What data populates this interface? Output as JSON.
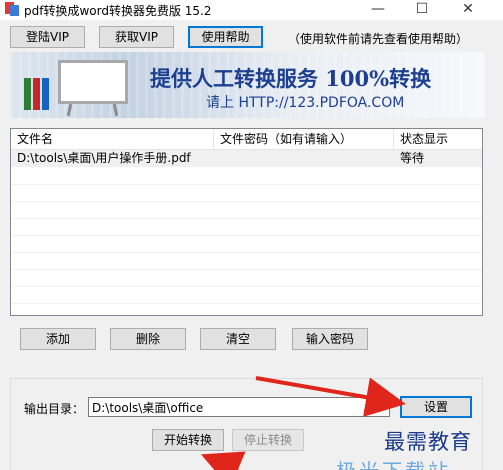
{
  "window": {
    "title": "pdf转换成word转换器免费版 15.2",
    "minimize": "—",
    "maximize": "☐",
    "close": "✕"
  },
  "toolbar": {
    "login_vip": "登陆VIP",
    "get_vip": "获取VIP",
    "help": "使用帮助",
    "hint": "（使用软件前请先查看使用帮助）"
  },
  "banner": {
    "title": "提供人工转换服务 100%转换",
    "subtitle": "请上  HTTP://123.PDFOA.COM"
  },
  "file_list": {
    "columns": [
      "文件名",
      "文件密码（如有请输入）",
      "状态显示"
    ],
    "rows": [
      {
        "name": "D:\\tools\\桌面\\用户操作手册.pdf",
        "password": "",
        "status": "等待"
      }
    ]
  },
  "actions": {
    "add": "添加",
    "delete": "删除",
    "clear": "清空",
    "enter_password": "输入密码"
  },
  "output": {
    "label": "输出目录：",
    "path": "D:\\tools\\桌面\\office",
    "settings": "设置"
  },
  "convert": {
    "start": "开始转换",
    "stop": "停止转换"
  },
  "watermark": {
    "text": "最需教育",
    "bottom": "极光下载站"
  },
  "colors": {
    "arrow": "#e0261b",
    "banner_text": "#1d3f8f",
    "watermark": "#1a3a8a",
    "focus": "#0078d7"
  }
}
